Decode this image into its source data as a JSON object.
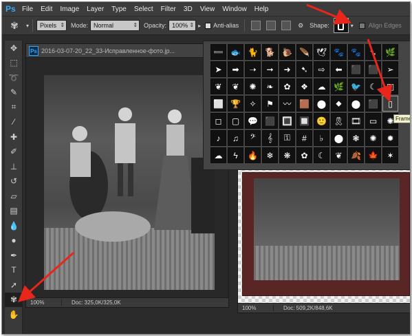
{
  "app": {
    "logo": "Ps"
  },
  "menu": [
    "File",
    "Edit",
    "Image",
    "Layer",
    "Type",
    "Select",
    "Filter",
    "3D",
    "View",
    "Window",
    "Help"
  ],
  "options": {
    "pixels_value": "Pixels",
    "mode_label": "Mode:",
    "mode_value": "Normal",
    "opacity_label": "Opacity:",
    "opacity_value": "100%",
    "antialias_label": "Anti-alias",
    "shape_label": "Shape:",
    "align_edges_label": "Align Edges"
  },
  "doc1": {
    "title": "2016-03-07-20_22_33-Исправленное-фото.jp...",
    "zoom": "100%",
    "doc_size": "Doc: 325,0K/325,0K"
  },
  "doc2": {
    "zoom": "100%",
    "doc_size": "Doc: 509,2K/848,6K"
  },
  "tooltip": "Frame",
  "shapes": [
    "➖",
    "🐟",
    "🐈",
    "🐕",
    "🐌",
    "🪶",
    "🕊",
    "🐾",
    "🐾",
    "➷",
    "🌿",
    "➤",
    "➡",
    "➝",
    "➞",
    "➜",
    "➷",
    "⇨",
    "⬅",
    "⬛",
    "⬛",
    "➢",
    "❦",
    "❦",
    "✺",
    "❧",
    "✿",
    "❖",
    "☁",
    "🌿",
    "🐦",
    "☾",
    "◫",
    "⬜",
    "🏆",
    "✧",
    "⚑",
    "〰",
    "🟫",
    "⬤",
    "⬥",
    "⬤",
    "⬛",
    "▯",
    "◻",
    "▢",
    "💬",
    "⬛",
    "🔳",
    "🔲",
    "🙂",
    "🎗",
    "🎞",
    "▭",
    "✺",
    "♪",
    "♫",
    "𝄢",
    "𝄞",
    "⚿",
    "#",
    "♭",
    "⬤",
    "❃",
    "✺",
    "✹",
    "☁",
    "ϟ",
    "🔥",
    "❄",
    "❋",
    "✿",
    "☾",
    "❦",
    "🍂",
    "🍁",
    "✶"
  ],
  "selected_shape_index": 43,
  "arrow_color": "#e8261c"
}
